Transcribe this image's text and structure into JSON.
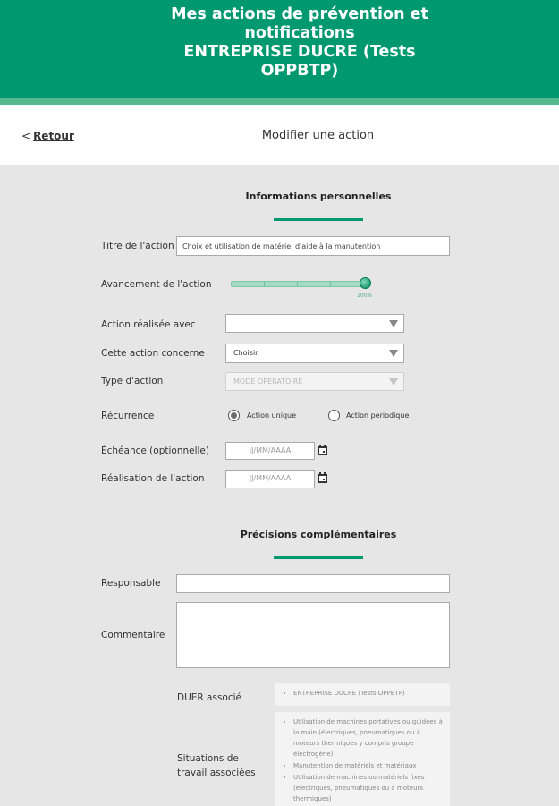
{
  "header": {
    "title_line1": "Mes actions de prévention et",
    "title_line2": "notifications",
    "title_line3": "ENTREPRISE DUCRE (Tests",
    "title_line4": "OPPBTP)"
  },
  "nav": {
    "back_lt": "<",
    "back_label": "Retour",
    "page_title": "Modifier une action"
  },
  "section1": {
    "title": "Informations personnelles"
  },
  "form": {
    "titre_label": "Titre de l'action",
    "titre_value": "Choix et utilisation de matériel d'aide à la manutention",
    "avancement_label": "Avancement de l'action",
    "avancement_value": 1.0,
    "avancement_text": "100%",
    "realisee_label": "Action réalisée avec",
    "realisee_value": "",
    "concerne_label": "Cette action concerne",
    "concerne_value": "Choisir",
    "type_label": "Type d'action",
    "type_value": "MODE OPERATOIRE",
    "recurrence_label": "Récurrence",
    "recurrence_option1": "Action unique",
    "recurrence_option2": "Action periodique",
    "echeance_label": "Échéance (optionnelle)",
    "echeance_placeholder": "JJ/MM/AAAA",
    "realisation_label": "Réalisation de l'action",
    "realisation_placeholder": "JJ/MM/AAAA"
  },
  "section2": {
    "title": "Précisions complémentaires"
  },
  "details": {
    "responsable_label": "Responsable",
    "responsable_value": "",
    "commentaire_label": "Commentaire",
    "commentaire_value": "",
    "duer_label": "DUER associé",
    "duer_items": [
      "ENTREPRISE DUCRE (Tests OPPBTP)"
    ],
    "situations_label_line1": "Situations de",
    "situations_label_line2": "travail associées",
    "situations_items": [
      "Utilisation de machines portatives ou guidées à la main (électriques, pneumatiques ou à moteurs thermiques y compris groupe électrogène)",
      "Manutention de matériels et matériaux",
      "Utilisation de machines ou matériels fixes (électriques, pneumatiques ou à moteurs thermiques)"
    ]
  },
  "colors": {
    "brand_green": "#00996f",
    "stripe_green": "#56b98e",
    "background_gray": "#e6e6e6"
  },
  "icons": {
    "calendar": "calendar-icon",
    "select_caret": "caret-down-icon",
    "slider_thumb": "slider-thumb"
  }
}
